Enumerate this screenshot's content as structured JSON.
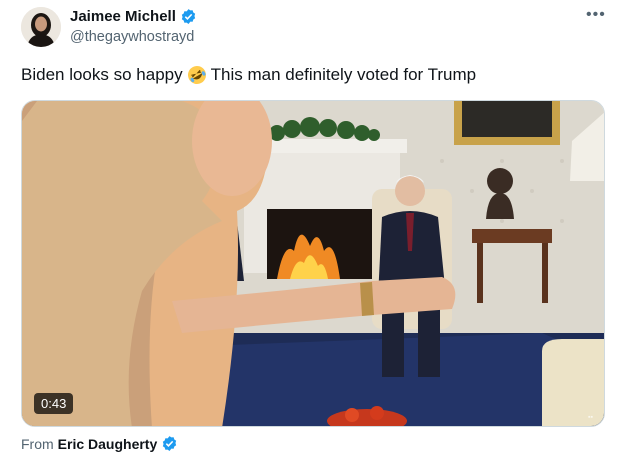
{
  "author": {
    "display_name": "Jaimee Michell",
    "handle": "@thegaywhostrayd",
    "verified_icon": "verified-badge-icon"
  },
  "more_label": "•••",
  "tweet": {
    "text_before": "Biden looks so happy",
    "emoji": "rolling-on-floor-laughing-emoji",
    "text_after": "This man definitely voted for Trump"
  },
  "media": {
    "duration": "0:43"
  },
  "source": {
    "prefix": "From",
    "name": "Eric Daugherty"
  },
  "colors": {
    "verified_blue": "#1d9bf0",
    "secondary_text": "#536471"
  }
}
